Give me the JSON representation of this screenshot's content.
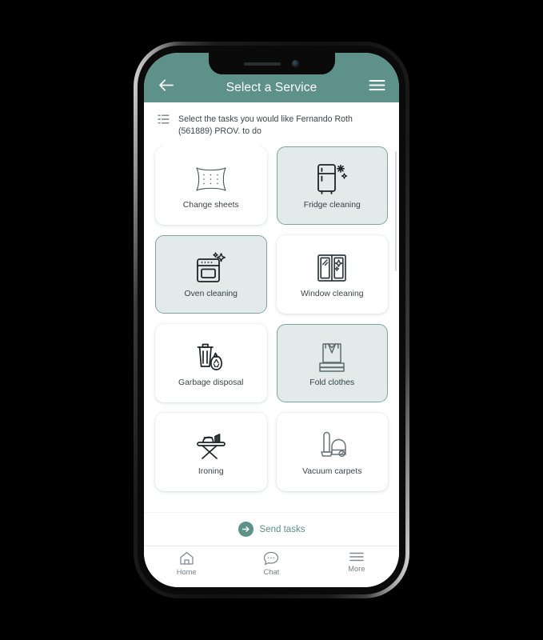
{
  "app": {
    "header": {
      "title": "Select a Service",
      "back_icon": "arrow-left-icon",
      "menu_icon": "hamburger-menu-icon",
      "background_color": "#5e9189"
    },
    "subtitle": {
      "icon": "list-icon",
      "text": "Select the tasks you would like Fernando Roth (561889) PROV. to do"
    },
    "services": [
      {
        "label": "Change sheets",
        "icon": "pillow-icon",
        "selected": false
      },
      {
        "label": "Fridge cleaning",
        "icon": "fridge-icon",
        "selected": true
      },
      {
        "label": "Oven cleaning",
        "icon": "oven-icon",
        "selected": true
      },
      {
        "label": "Window cleaning",
        "icon": "window-icon",
        "selected": false
      },
      {
        "label": "Garbage disposal",
        "icon": "trash-bag-icon",
        "selected": false
      },
      {
        "label": "Fold clothes",
        "icon": "folded-clothes-icon",
        "selected": true
      },
      {
        "label": "Ironing",
        "icon": "ironing-board-icon",
        "selected": false
      },
      {
        "label": "Vacuum carpets",
        "icon": "vacuum-cleaner-icon",
        "selected": false
      }
    ],
    "send": {
      "label": "Send tasks",
      "icon": "arrow-right-circle-icon",
      "accent_color": "#5e9189"
    },
    "bottom_nav": [
      {
        "label": "Home",
        "icon": "home-icon"
      },
      {
        "label": "Chat",
        "icon": "chat-bubble-icon"
      },
      {
        "label": "More",
        "icon": "hamburger-menu-icon"
      }
    ],
    "colors": {
      "selected_card_bg": "#e2eaea",
      "selected_card_border": "#81a29f",
      "card_bg": "#ffffff",
      "text": "#3b4448"
    }
  }
}
